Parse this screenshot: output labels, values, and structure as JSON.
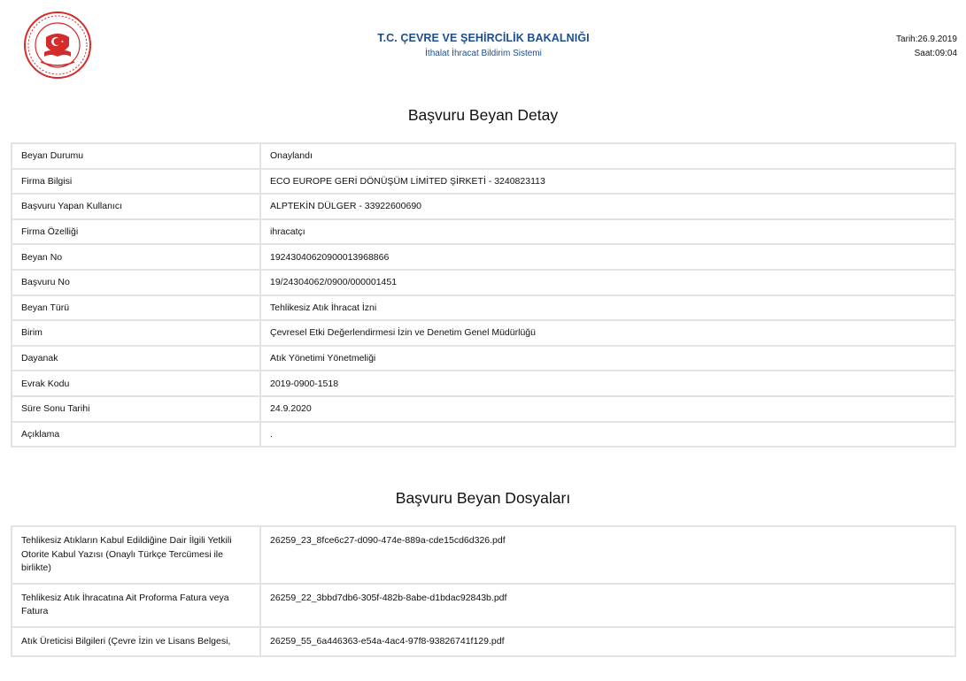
{
  "header": {
    "ministry": "T.C. ÇEVRE VE ŞEHİRCİLİK BAKALNIĞI",
    "system": "İthalat İhracat Bildirim Sistemi",
    "date": "Tarih:26.9.2019",
    "time": "Saat:09:04",
    "logo_icon": "ministry-seal-icon"
  },
  "detail": {
    "title": "Başvuru Beyan Detay",
    "rows": [
      {
        "label": "Beyan Durumu",
        "value": "Onaylandı"
      },
      {
        "label": "Firma Bilgisi",
        "value": "ECO EUROPE GERİ DÖNÜŞÜM LİMİTED ŞİRKETİ - 3240823113"
      },
      {
        "label": "Başvuru Yapan Kullanıcı",
        "value": "ALPTEKİN DÜLGER - 33922600690"
      },
      {
        "label": "Firma Özelliği",
        "value": "ihracatçı"
      },
      {
        "label": "Beyan No",
        "value": "19243040620900013968866"
      },
      {
        "label": "Başvuru No",
        "value": "19/24304062/0900/000001451"
      },
      {
        "label": "Beyan Türü",
        "value": "Tehlikesiz Atık İhracat İzni"
      },
      {
        "label": "Birim",
        "value": "Çevresel Etki Değerlendirmesi İzin ve Denetim Genel Müdürlüğü"
      },
      {
        "label": "Dayanak",
        "value": "Atık Yönetimi Yönetmeliği"
      },
      {
        "label": "Evrak Kodu",
        "value": "2019-0900-1518"
      },
      {
        "label": "Süre Sonu Tarihi",
        "value": "24.9.2020"
      },
      {
        "label": "Açıklama",
        "value": "."
      }
    ]
  },
  "files": {
    "title": "Başvuru Beyan Dosyaları",
    "rows": [
      {
        "label": "Tehlikesiz Atıkların Kabul Edildiğine Dair İlgili Yetkili Otorite Kabul Yazısı (Onaylı Türkçe Tercümesi ile birlikte)",
        "file": "26259_23_8fce6c27-d090-474e-889a-cde15cd6d326.pdf"
      },
      {
        "label": "Tehlikesiz Atık İhracatına Ait Proforma Fatura veya Fatura",
        "file": "26259_22_3bbd7db6-305f-482b-8abe-d1bdac92843b.pdf"
      },
      {
        "label": "Atık Üreticisi Bilgileri (Çevre İzin ve Lisans Belgesi,",
        "file": "26259_55_6a446363-e54a-4ac4-97f8-93826741f129.pdf"
      }
    ]
  }
}
